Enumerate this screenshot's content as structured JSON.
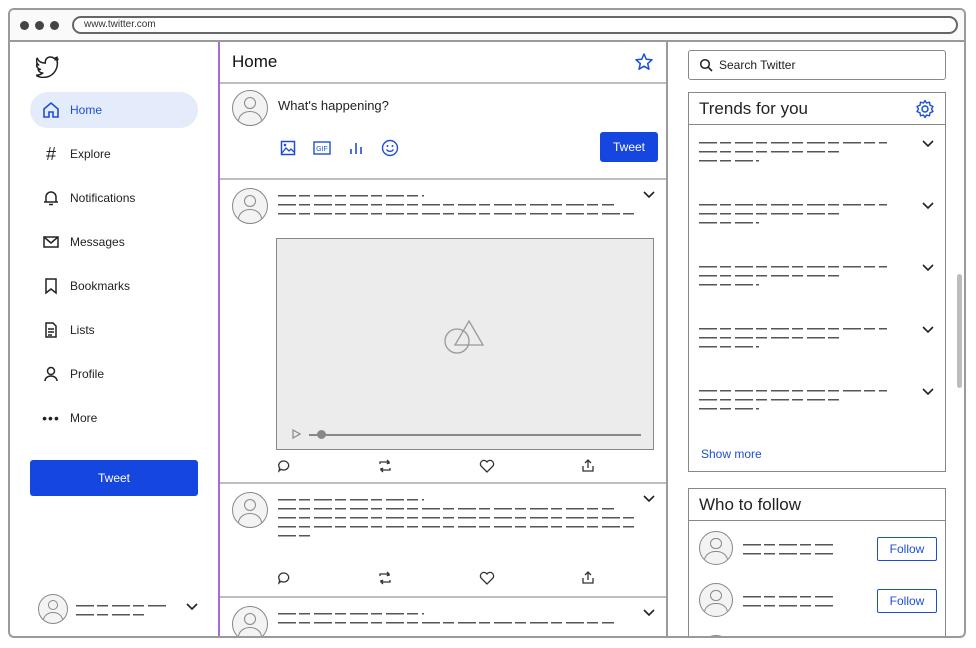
{
  "browser": {
    "url": "www.twitter.com"
  },
  "nav": {
    "items": [
      {
        "label": "Home",
        "icon": "home-icon"
      },
      {
        "label": "Explore",
        "icon": "hash-icon"
      },
      {
        "label": "Notifications",
        "icon": "bell-icon"
      },
      {
        "label": "Messages",
        "icon": "mail-icon"
      },
      {
        "label": "Bookmarks",
        "icon": "bookmark-icon"
      },
      {
        "label": "Lists",
        "icon": "list-icon"
      },
      {
        "label": "Profile",
        "icon": "user-icon"
      },
      {
        "label": "More",
        "icon": "more-icon"
      }
    ],
    "tweet_label": "Tweet"
  },
  "center": {
    "title": "Home",
    "compose_placeholder": "What's happening?",
    "compose_button": "Tweet"
  },
  "search": {
    "placeholder": "Search Twitter"
  },
  "trends": {
    "title": "Trends for you",
    "show_more": "Show more"
  },
  "who_to_follow": {
    "title": "Who to follow",
    "follow_label": "Follow"
  },
  "colors": {
    "accent": "#1546e0",
    "active_bg": "#e4ecfb",
    "divider": "#a56cd8"
  }
}
